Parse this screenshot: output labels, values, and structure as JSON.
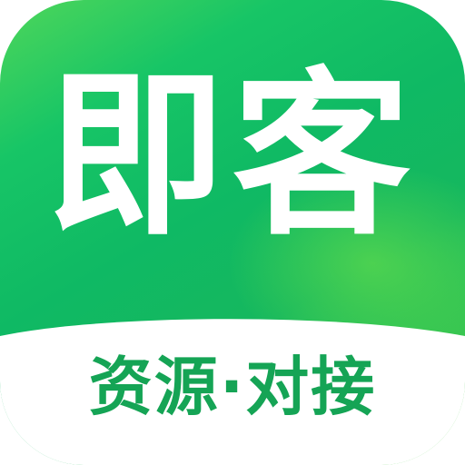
{
  "app_icon": {
    "title": "即客",
    "slogan": "资源·对接"
  },
  "colors": {
    "brand_green": "#13b862",
    "light_green": "#5ad443",
    "slogan_green": "#15a455",
    "background_white": "#ffffff"
  }
}
